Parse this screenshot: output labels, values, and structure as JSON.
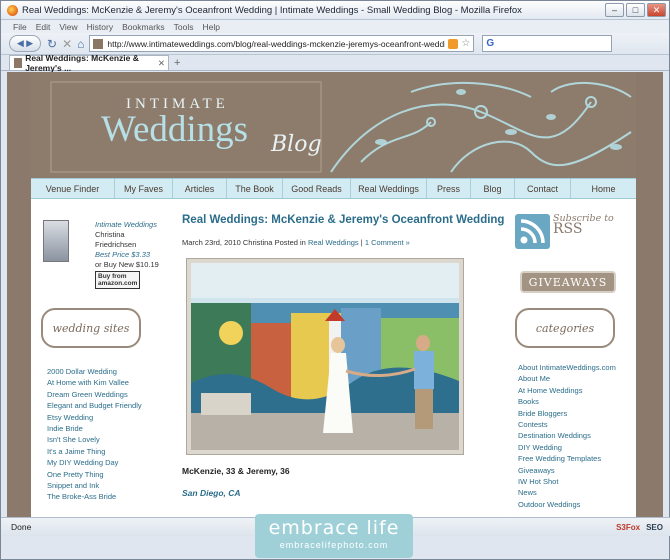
{
  "browser": {
    "title": "Real Weddings: McKenzie & Jeremy's Oceanfront Wedding | Intimate Weddings - Small Wedding Blog - Mozilla Firefox",
    "menu": [
      "File",
      "Edit",
      "View",
      "History",
      "Bookmarks",
      "Tools",
      "Help"
    ],
    "url": "http://www.intimateweddings.com/blog/real-weddings-mckenzie-jeremys-oceanfront-wedding/",
    "search_engine_icon": "google-icon",
    "tab_label": "Real Weddings: McKenzie & Jeremy's ...",
    "status": "Done",
    "status_right": [
      "S3Fox",
      "SEO"
    ]
  },
  "site": {
    "logo_small": "INTIMATE",
    "logo_big": "Weddings",
    "logo_blog": "Blog",
    "nav": [
      "Venue Finder",
      "My Faves",
      "Articles",
      "The Book",
      "Good Reads",
      "Real Weddings",
      "Press",
      "Blog",
      "Contact",
      "Home"
    ]
  },
  "book": {
    "title": "Intimate Weddings",
    "author": "Christina Friedrichsen",
    "best_price": "Best Price $3.33",
    "buy_new": "or Buy New $10.19",
    "amazon": [
      "Buy from",
      "amazon.com"
    ]
  },
  "left_sidebar": {
    "heading": "wedding sites",
    "links": [
      "2000 Dollar Wedding",
      "At Home with Kim Vallee",
      "Dream Green Weddings",
      "Elegant and Budget Friendly",
      "Etsy Wedding",
      "Indie Bride",
      "Isn't She Lovely",
      "It's a Jaime Thing",
      "My DIY Wedding Day",
      "One Pretty Thing",
      "Snippet and Ink",
      "The Broke-Ass Bride"
    ]
  },
  "post": {
    "title": "Real Weddings: McKenzie & Jeremy's Oceanfront Wedding",
    "date": "March 23rd, 2010 Christina",
    "posted_in": "Posted in",
    "category": "Real Weddings",
    "separator": "|",
    "comments": "1 Comment »",
    "caption": "McKenzie, 33 & Jeremy, 36",
    "location": "San Diego, CA"
  },
  "right_sidebar": {
    "subscribe_line1": "Subscribe to",
    "subscribe_line2": "RSS",
    "giveaways": "GIVEAWAYS",
    "categories_heading": "categories",
    "categories": [
      "About IntimateWeddings.com",
      "About Me",
      "At Home Weddings",
      "Books",
      "Bride Bloggers",
      "Contests",
      "Destination Weddings",
      "DIY Wedding",
      "Free Wedding Templates",
      "Giveaways",
      "IW Hot Shot",
      "News",
      "Outdoor Weddings"
    ]
  },
  "watermark": {
    "line1": "embrace life",
    "line2": "embracelifephoto.com"
  },
  "colors": {
    "header_brown": "#8d7c6c",
    "nav_blue": "#d3ecf3",
    "link_teal": "#2b6d8a",
    "watermark": "#9fd0d8"
  }
}
